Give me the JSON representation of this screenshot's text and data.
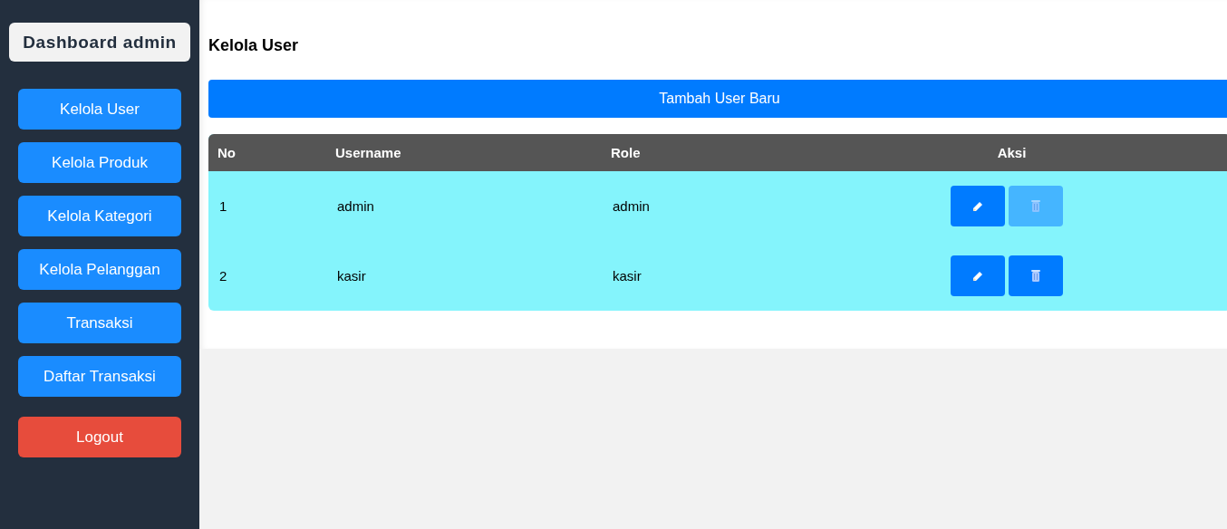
{
  "sidebar": {
    "title": "Dashboard admin",
    "items": [
      {
        "label": "Kelola User",
        "kind": "nav"
      },
      {
        "label": "Kelola Produk",
        "kind": "nav"
      },
      {
        "label": "Kelola Kategori",
        "kind": "nav"
      },
      {
        "label": "Kelola Pelanggan",
        "kind": "nav"
      },
      {
        "label": "Transaksi",
        "kind": "nav"
      },
      {
        "label": "Daftar Transaksi",
        "kind": "nav"
      },
      {
        "label": "Logout",
        "kind": "logout"
      }
    ]
  },
  "page_title": "Kelola User",
  "add_button": "Tambah User Baru",
  "table": {
    "columns": [
      "No",
      "Username",
      "Role",
      "Aksi"
    ],
    "rows": [
      {
        "no": "1",
        "username": "admin",
        "role": "admin",
        "delete_disabled": true
      },
      {
        "no": "2",
        "username": "kasir",
        "role": "kasir",
        "delete_disabled": false
      }
    ]
  }
}
